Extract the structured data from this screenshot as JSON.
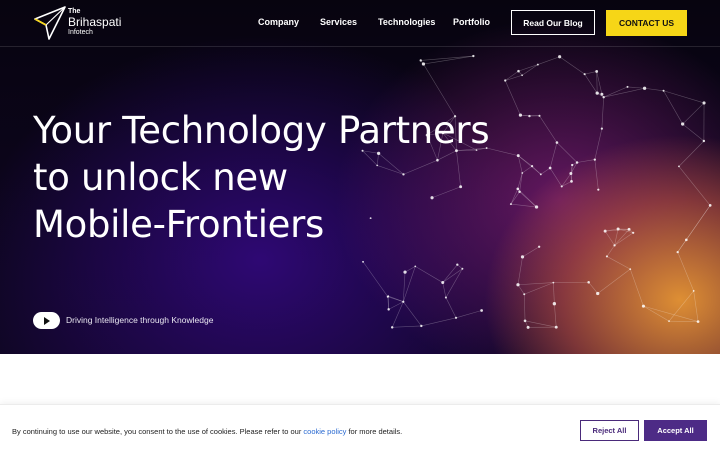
{
  "brand": {
    "line1": "The",
    "line2": "Brihaspati",
    "line3": "Infotech",
    "logo_icon": "paper-plane-logo-icon"
  },
  "nav": {
    "items": [
      {
        "label": "Company"
      },
      {
        "label": "Services"
      },
      {
        "label": "Technologies"
      },
      {
        "label": "Portfolio"
      }
    ],
    "blog_button": "Read Our Blog",
    "contact_button": "CONTACT US"
  },
  "hero": {
    "headline": [
      "Your Technology Partners",
      "to unlock new",
      "Mobile-Frontiers"
    ],
    "tagline": "Driving Intelligence through Knowledge",
    "play_icon": "play-icon"
  },
  "cookie": {
    "text_before": "By continuing to use our website, you consent to the use of cookies. Please refer to our ",
    "link": "cookie policy",
    "text_after": " for more details.",
    "reject": "Reject All",
    "accept": "Accept All"
  },
  "colors": {
    "accent_yellow": "#f6d617",
    "accent_purple": "#4d2b86",
    "hero_dark": "#07040f",
    "hero_orange": "#e89634"
  }
}
